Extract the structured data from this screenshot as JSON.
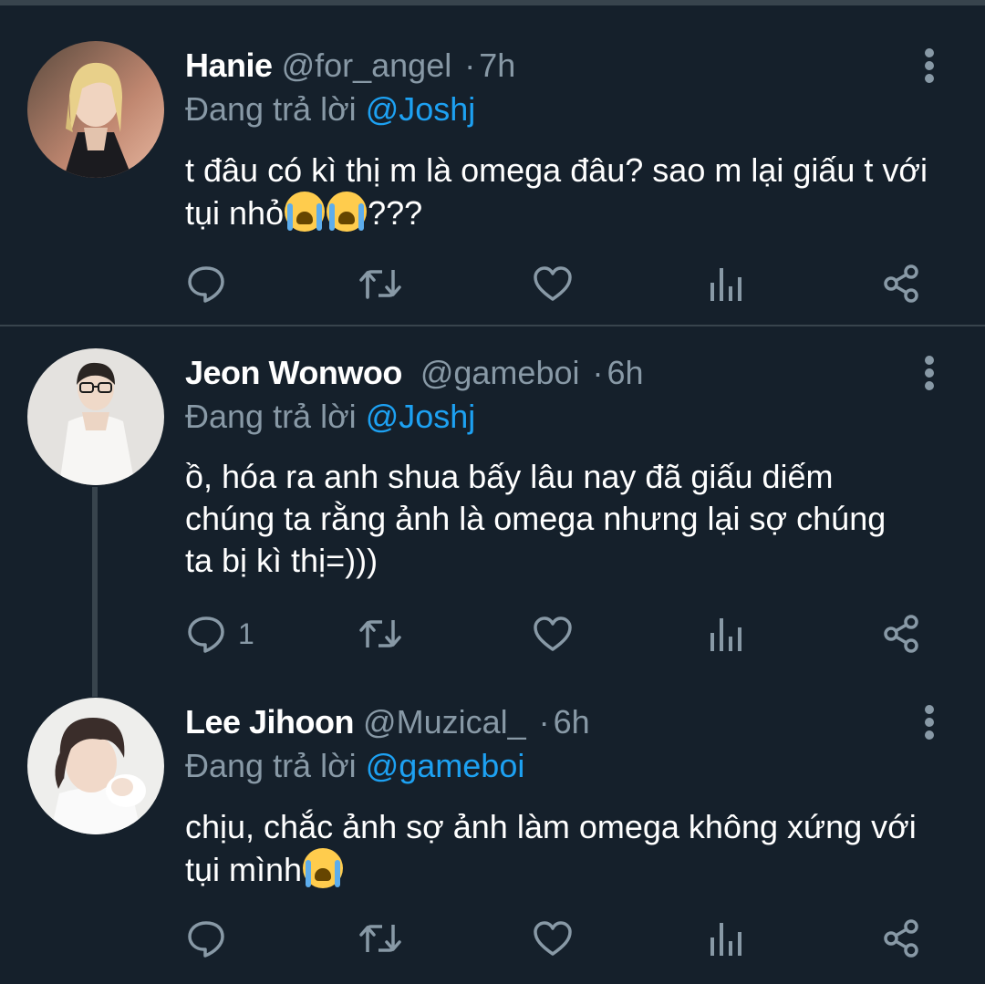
{
  "tweets": [
    {
      "name": "Hanie",
      "handle": "@for_angel",
      "separator": "·",
      "time": "7h",
      "reply_prefix": "Đang trả lời",
      "reply_to": "@Joshj",
      "text_before": "t đâu có kì thị m là omega đâu? sao m lại giấu t với tụi nhỏ",
      "text_after": "???",
      "emojis": [
        "loudly-crying-face",
        "loudly-crying-face"
      ],
      "reply_count": ""
    },
    {
      "name": "Jeon Wonwoo",
      "handle": "@gameboi",
      "separator": "·",
      "time": "6h",
      "reply_prefix": "Đang trả lời",
      "reply_to": "@Joshj",
      "text": "ồ, hóa ra anh shua bấy lâu nay đã giấu diếm chúng ta rằng ảnh là omega nhưng lại sợ chúng ta bị kì thị=)))",
      "reply_count": "1"
    },
    {
      "name": "Lee Jihoon",
      "handle": "@Muzical_",
      "separator": "·",
      "time": "6h",
      "reply_prefix": "Đang trả lời",
      "reply_to": "@gameboi",
      "text_before": "chịu, chắc ảnh sợ ảnh làm omega không xứng với tụi mình",
      "emojis": [
        "loudly-crying-face"
      ],
      "reply_count": ""
    }
  ],
  "icons": {
    "reply": "reply-icon",
    "retweet": "retweet-icon",
    "like": "heart-icon",
    "analytics": "analytics-icon",
    "share": "share-icon",
    "more": "more-vertical-icon"
  },
  "colors": {
    "background": "#15202b",
    "divider": "#38444d",
    "secondary_text": "#8899a6",
    "accent": "#1da1f2"
  }
}
